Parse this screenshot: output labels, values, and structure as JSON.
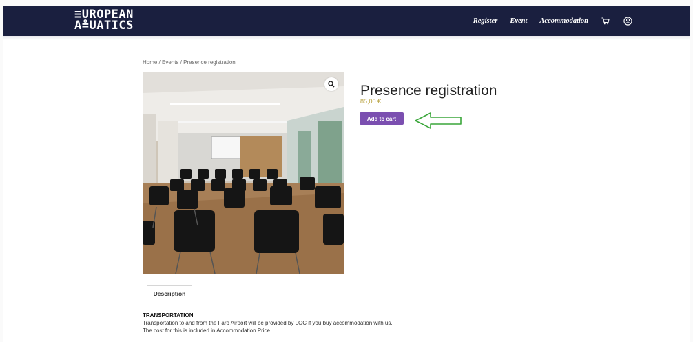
{
  "header": {
    "logo_line1": "≡UROPEAN",
    "logo_line2": "A≗UATICS",
    "nav": [
      "Register",
      "Event",
      "Accommodation"
    ],
    "icons": [
      "cart-icon",
      "account-icon"
    ],
    "bg_color": "#1a1f3f"
  },
  "breadcrumb": "Home / Events / Presence registration",
  "product": {
    "title": "Presence registration",
    "price": "85,00 €",
    "add_to_cart_label": "Add to cart",
    "button_color": "#7b4fb0",
    "price_color": "#b7a13e"
  },
  "annotation": {
    "arrow_color": "#3aa63a"
  },
  "tabs": [
    "Description"
  ],
  "description": {
    "heading": "TRANSPORTATION",
    "lines": [
      "Transportation to and from the Faro Airport will be provided by LOC if you buy accommodation with us.",
      "The cost for this is included in Accommodation Price."
    ]
  }
}
